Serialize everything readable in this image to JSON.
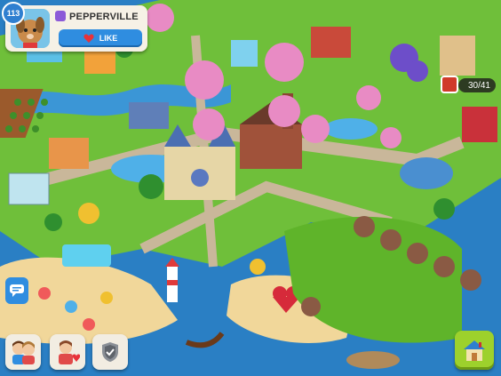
{
  "profile": {
    "level": "113",
    "town_name": "PEPPERVILLE",
    "like_label": "LIKE"
  },
  "counters": {
    "barn_count": "30/41"
  },
  "icons": {
    "like": "heart-icon",
    "chat": "chat-bubble-icon",
    "friends": "friends-icon",
    "gift": "gift-icon",
    "shield": "shield-icon",
    "build": "build-house-icon",
    "barn": "barn-icon",
    "town": "town-badge-icon"
  },
  "colors": {
    "sea": "#2a7fc4",
    "grass": "#6fbf3a",
    "road": "#c9b79a",
    "blossom": "#e88bc4",
    "accent_blue": "#2f8de0",
    "accent_green": "#9dd12c"
  }
}
